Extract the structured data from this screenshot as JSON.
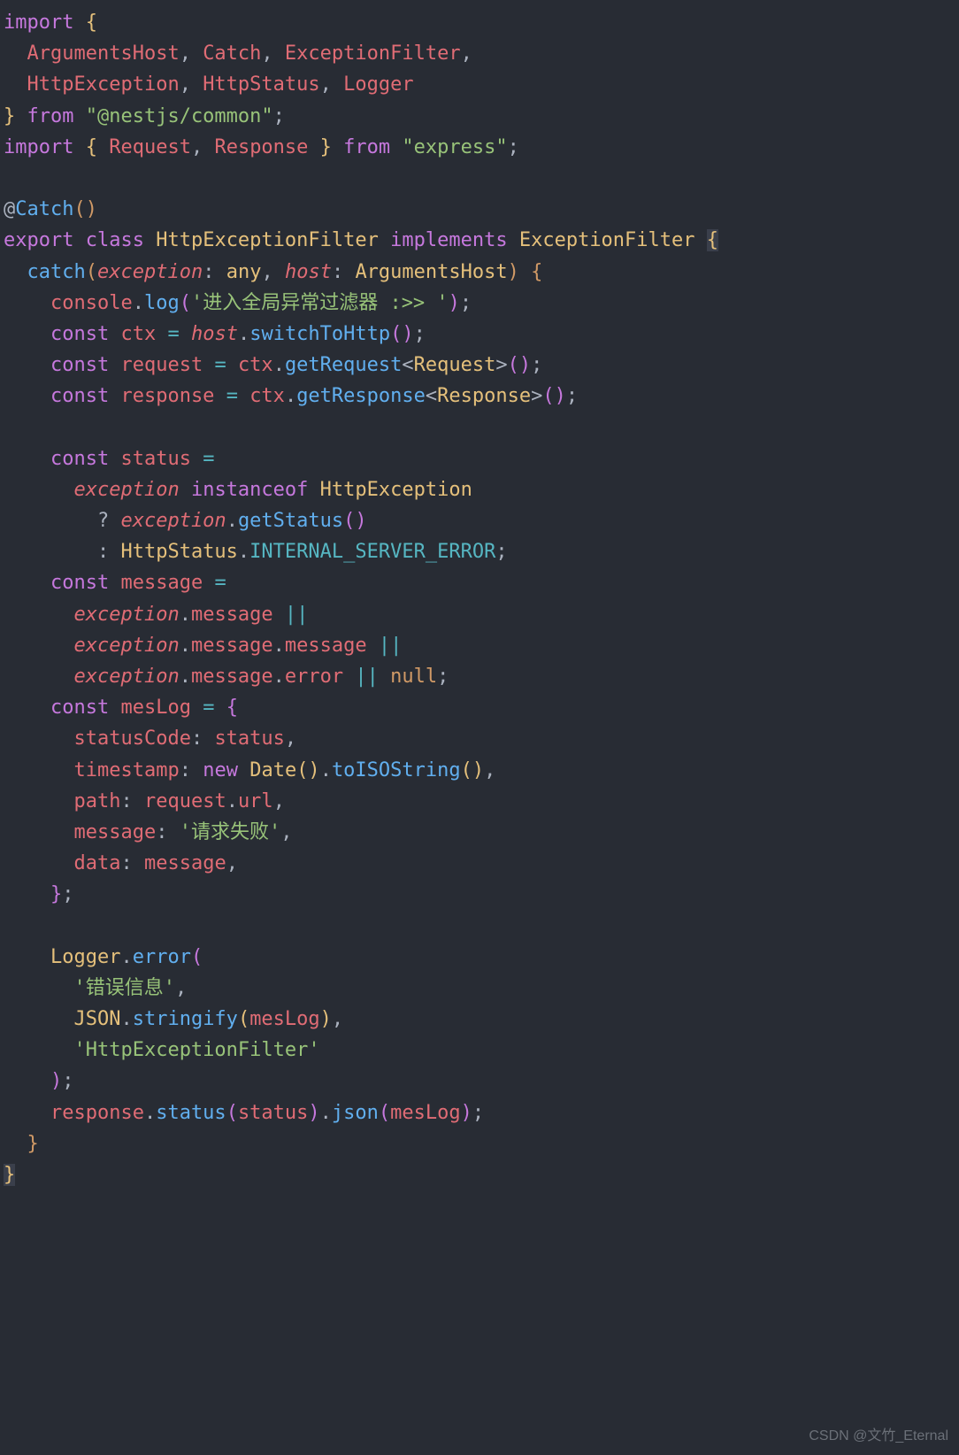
{
  "code": {
    "l1_import": "import",
    "l2_ArgumentsHost": "ArgumentsHost",
    "l2_Catch": "Catch",
    "l2_ExceptionFilter": "ExceptionFilter",
    "l3_HttpException": "HttpException",
    "l3_HttpStatus": "HttpStatus",
    "l3_Logger": "Logger",
    "l4_from": "from",
    "l4_module": "\"@nestjs/common\"",
    "l5_import": "import",
    "l5_Request": "Request",
    "l5_Response": "Response",
    "l5_from": "from",
    "l5_module": "\"express\"",
    "l7_at": "@",
    "l7_Catch": "Catch",
    "l8_export": "export",
    "l8_class": "class",
    "l8_HttpExceptionFilter": "HttpExceptionFilter",
    "l8_implements": "implements",
    "l8_ExceptionFilter": "ExceptionFilter",
    "l9_catch": "catch",
    "l9_exception": "exception",
    "l9_any": "any",
    "l9_host": "host",
    "l9_ArgumentsHost": "ArgumentsHost",
    "l10_console": "console",
    "l10_log": "log",
    "l10_str": "'进入全局异常过滤器 :>> '",
    "l11_const": "const",
    "l11_ctx": "ctx",
    "l11_host": "host",
    "l11_switchToHttp": "switchToHttp",
    "l12_const": "const",
    "l12_request": "request",
    "l12_ctx": "ctx",
    "l12_getRequest": "getRequest",
    "l12_Request": "Request",
    "l13_const": "const",
    "l13_response": "response",
    "l13_ctx": "ctx",
    "l13_getResponse": "getResponse",
    "l13_Response": "Response",
    "l15_const": "const",
    "l15_status": "status",
    "l16_exception": "exception",
    "l16_instanceof": "instanceof",
    "l16_HttpException": "HttpException",
    "l17_exception": "exception",
    "l17_getStatus": "getStatus",
    "l18_HttpStatus": "HttpStatus",
    "l18_INTERNAL": "INTERNAL_SERVER_ERROR",
    "l19_const": "const",
    "l19_message": "message",
    "l20_exception": "exception",
    "l20_message": "message",
    "l21_exception": "exception",
    "l21_message1": "message",
    "l21_message2": "message",
    "l22_exception": "exception",
    "l22_message": "message",
    "l22_error": "error",
    "l22_null": "null",
    "l23_const": "const",
    "l23_mesLog": "mesLog",
    "l24_statusCode": "statusCode",
    "l24_status": "status",
    "l25_timestamp": "timestamp",
    "l25_new": "new",
    "l25_Date": "Date",
    "l25_toISOString": "toISOString",
    "l26_path": "path",
    "l26_request": "request",
    "l26_url": "url",
    "l27_message": "message",
    "l27_str": "'请求失败'",
    "l28_data": "data",
    "l28_message": "message",
    "l31_Logger": "Logger",
    "l31_error": "error",
    "l32_str": "'错误信息'",
    "l33_JSON": "JSON",
    "l33_stringify": "stringify",
    "l33_mesLog": "mesLog",
    "l34_str": "'HttpExceptionFilter'",
    "l36_response": "response",
    "l36_status": "status",
    "l36_statusArg": "status",
    "l36_json": "json",
    "l36_mesLog": "mesLog"
  },
  "watermark": "CSDN @文竹_Eternal"
}
